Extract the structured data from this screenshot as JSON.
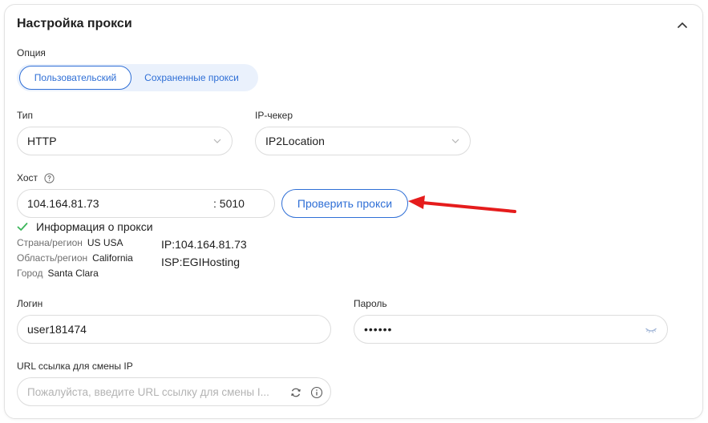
{
  "panel": {
    "title": "Настройка прокси"
  },
  "option": {
    "label": "Опция",
    "tabs": [
      "Пользовательский",
      "Сохраненные прокси"
    ]
  },
  "type": {
    "label": "Тип",
    "value": "HTTP"
  },
  "ip_checker": {
    "label": "IP-чекер",
    "value": "IP2Location"
  },
  "host": {
    "label": "Хост",
    "address": "104.164.81.73",
    "port": ": 5010",
    "check_button": "Проверить прокси"
  },
  "proxy_info": {
    "title": "Информация о прокси",
    "country_label": "Страна/регион",
    "country_value": "US USA",
    "region_label": "Область/регион",
    "region_value": "California",
    "city_label": "Город",
    "city_value": "Santa Clara",
    "ip": "IP:104.164.81.73",
    "isp": "ISP:EGIHosting"
  },
  "login": {
    "label": "Логин",
    "value": "user181474"
  },
  "password": {
    "label": "Пароль",
    "masked": "••••••"
  },
  "url_change": {
    "label": "URL ссылка для смены IP",
    "placeholder": "Пожалуйста, введите URL ссылку для смены I..."
  },
  "colors": {
    "accent": "#2f6fd6",
    "arrow": "#e51c1c",
    "success": "#3bb55a"
  }
}
